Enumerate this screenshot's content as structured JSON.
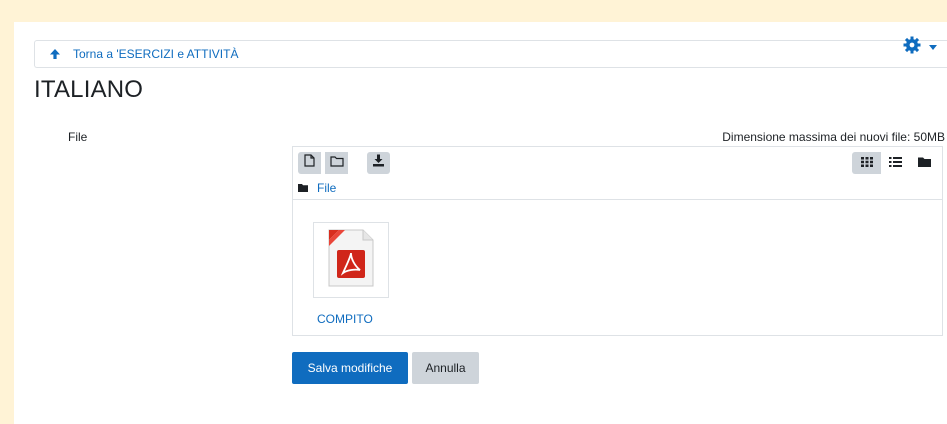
{
  "nav": {
    "back_label": "Torna a 'ESERCIZI e ATTIVITÀ"
  },
  "page": {
    "title": "ITALIANO"
  },
  "form": {
    "file_label": "File",
    "max_size_text": "Dimensione massima dei nuovi file: 50MB",
    "save_label": "Salva modifiche",
    "cancel_label": "Annulla"
  },
  "filemanager": {
    "breadcrumb": "File",
    "files": [
      {
        "name": "COMPITO",
        "name_second_line_partial": "...",
        "icon": "pdf-icon"
      }
    ],
    "view_mode": "icons"
  },
  "colors": {
    "accent": "#0f6cbf",
    "button_gray": "#ced4da",
    "frame_bg": "#fff3d6"
  }
}
